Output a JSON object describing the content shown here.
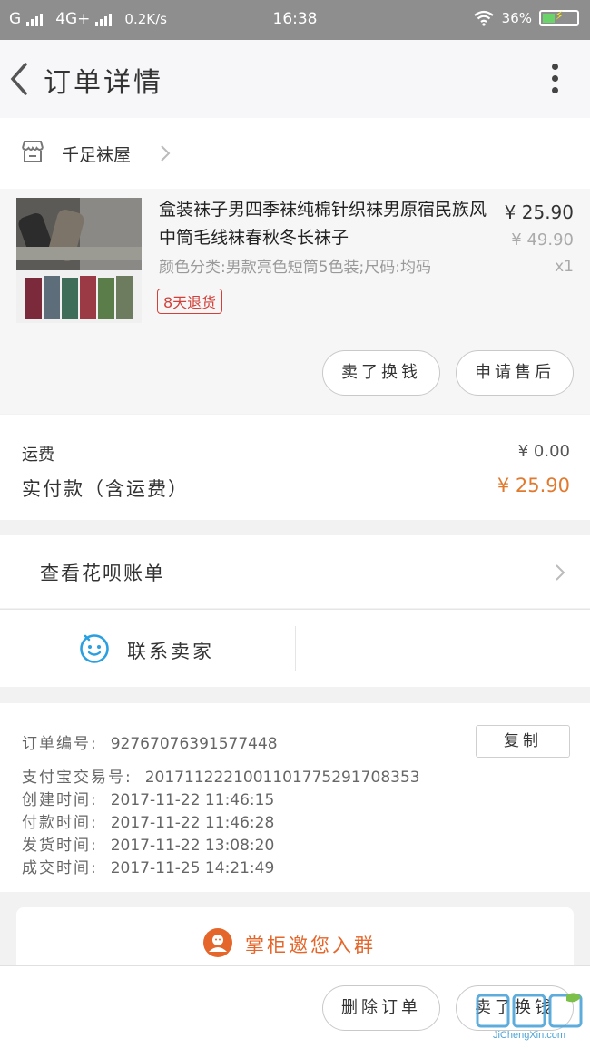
{
  "status_bar": {
    "carrier1": "G",
    "network": "4G+",
    "speed": "0.2K/s",
    "time": "16:38",
    "battery": "36%"
  },
  "nav": {
    "title": "订单详情",
    "back_icon": "chevron-left-icon",
    "more_icon": "more-vertical-icon"
  },
  "shop": {
    "name": "千足袜屋",
    "icon": "store-icon"
  },
  "product": {
    "title": "盒装袜子男四季袜纯棉针织袜男原宿民族风中筒毛线袜春秋冬长袜子",
    "sku": "颜色分类:男款亮色短筒5色装;尺码:均码",
    "badge": "8天退货",
    "price": "¥ 25.90",
    "original_price": "¥ 49.90",
    "quantity": "x1",
    "sell_button": "卖了换钱",
    "aftersale_button": "申请售后"
  },
  "fees": {
    "shipping_label": "运费",
    "shipping_value": "¥ 0.00",
    "paid_label": "实付款（含运费）",
    "paid_value": "¥ 25.90",
    "accent": "#e07a2f"
  },
  "huabei": {
    "label": "查看花呗账单"
  },
  "contact": {
    "label": "联系卖家",
    "icon": "chat-face-icon",
    "icon_color": "#2aa0e0"
  },
  "order_info": {
    "copy_button": "复制",
    "rows": [
      {
        "key": "订单编号:",
        "value": "92767076391577448"
      },
      {
        "key": "支付宝交易号:",
        "value": "2017112221001101775291708353"
      },
      {
        "key": "创建时间:",
        "value": "2017-11-22 11:46:15"
      },
      {
        "key": "付款时间:",
        "value": "2017-11-22 11:46:28"
      },
      {
        "key": "发货时间:",
        "value": "2017-11-22 13:08:20"
      },
      {
        "key": "成交时间:",
        "value": "2017-11-25 14:21:49"
      }
    ]
  },
  "group": {
    "label": "掌柜邀您入群",
    "icon": "shopkeeper-icon",
    "color": "#e4662a"
  },
  "bottom_bar": {
    "delete_button": "删除订单",
    "sell_button": "卖了换钱"
  },
  "watermark": {
    "logo": "集诚信",
    "site": "JiChengXin.com"
  }
}
